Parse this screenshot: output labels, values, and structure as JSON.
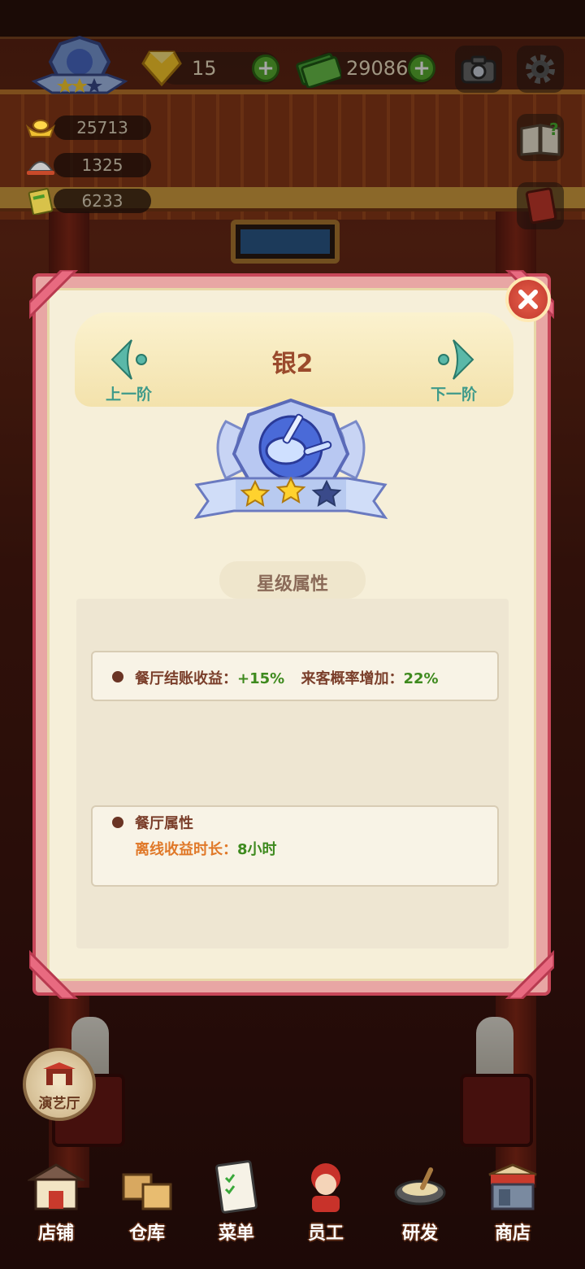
{
  "hud": {
    "gems": "15",
    "cash": "29086",
    "stats": [
      {
        "icon": "gold-ingot-icon",
        "value": "25713"
      },
      {
        "icon": "serving-cloche-icon",
        "value": "1325"
      },
      {
        "icon": "book-icon",
        "value": "6233"
      }
    ],
    "plus_label": "+"
  },
  "modal": {
    "tier_title": "银2",
    "prev_label": "上一阶",
    "next_label": "下一阶",
    "badge_stars_filled": 2,
    "badge_stars_total": 3,
    "section_title": "星级属性",
    "bonus": {
      "checkout_label": "餐厅结账收益：",
      "checkout_value": "+15%",
      "visit_label": "来客概率增加：",
      "visit_value": "22%"
    },
    "attributes": {
      "title": "餐厅属性",
      "offline_label": "离线收益时长：",
      "offline_value": "8小时"
    }
  },
  "side": {
    "hall_label": "演艺厅"
  },
  "bottom_nav": [
    {
      "label": "店铺",
      "icon": "shop-icon"
    },
    {
      "label": "仓库",
      "icon": "warehouse-icon"
    },
    {
      "label": "菜单",
      "icon": "menu-icon"
    },
    {
      "label": "员工",
      "icon": "staff-icon"
    },
    {
      "label": "研发",
      "icon": "research-icon"
    },
    {
      "label": "商店",
      "icon": "store-icon"
    }
  ],
  "colors": {
    "title": "#9a4a2c",
    "accent_teal": "#3e9a8a",
    "value_green": "#3e8a1e",
    "attr_orange": "#e07828",
    "frame_pink": "#c8485a"
  }
}
